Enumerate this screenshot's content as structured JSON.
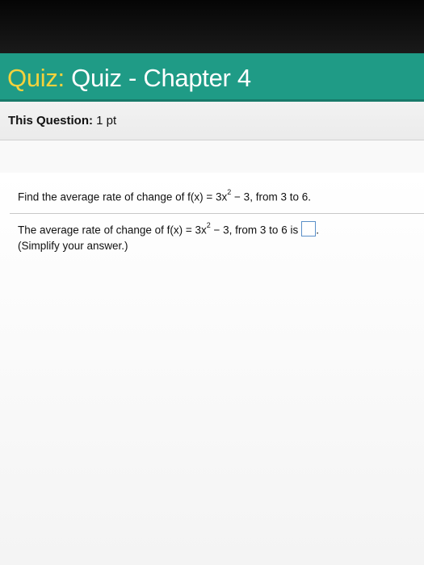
{
  "header": {
    "title_prefix": "Quiz:",
    "title_main": " Quiz - Chapter 4"
  },
  "question_info": {
    "label": "This Question:",
    "points": " 1 pt"
  },
  "question": {
    "prompt_before": "Find the average rate of change of f(x) = 3x",
    "exponent": "2",
    "prompt_after": " − 3, from 3 to 6."
  },
  "answer": {
    "text_before": "The average rate of change of f(x) = 3x",
    "exponent": "2",
    "text_after": " − 3, from 3 to 6 is",
    "box_value": "",
    "trailing": ".",
    "hint": "(Simplify your answer.)"
  }
}
